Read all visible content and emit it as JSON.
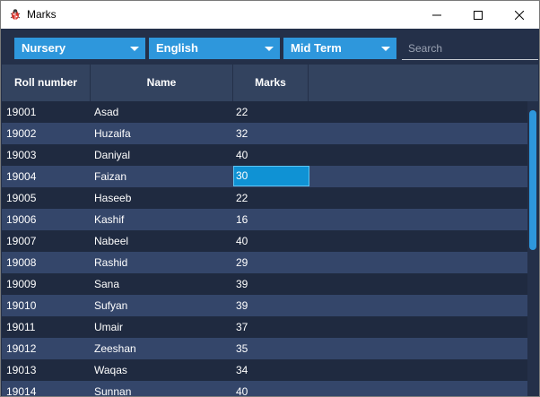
{
  "window": {
    "title": "Marks"
  },
  "toolbar": {
    "class_select": {
      "value": "Nursery"
    },
    "subject_select": {
      "value": "English"
    },
    "term_select": {
      "value": "Mid Term"
    },
    "search": {
      "placeholder": "Search"
    }
  },
  "table": {
    "columns": [
      "Roll number",
      "Name",
      "Marks"
    ],
    "rows": [
      {
        "roll": "19001",
        "name": "Asad",
        "marks": "22"
      },
      {
        "roll": "19002",
        "name": "Huzaifa",
        "marks": "32"
      },
      {
        "roll": "19003",
        "name": "Daniyal",
        "marks": "40"
      },
      {
        "roll": "19004",
        "name": "Faizan",
        "marks": "30"
      },
      {
        "roll": "19005",
        "name": "Haseeb",
        "marks": "22"
      },
      {
        "roll": "19006",
        "name": "Kashif",
        "marks": "16"
      },
      {
        "roll": "19007",
        "name": "Nabeel",
        "marks": "40"
      },
      {
        "roll": "19008",
        "name": "Rashid",
        "marks": "29"
      },
      {
        "roll": "19009",
        "name": "Sana",
        "marks": "39"
      },
      {
        "roll": "19010",
        "name": "Sufyan",
        "marks": "39"
      },
      {
        "roll": "19011",
        "name": "Umair",
        "marks": "37"
      },
      {
        "roll": "19012",
        "name": "Zeeshan",
        "marks": "35"
      },
      {
        "roll": "19013",
        "name": "Waqas",
        "marks": "34"
      },
      {
        "roll": "19014",
        "name": "Sunnan",
        "marks": "40"
      }
    ],
    "selected_cell": {
      "row": 3,
      "column": "marks"
    }
  },
  "icons": {
    "app": "bug-icon",
    "minimize": "minimize-icon",
    "maximize": "maximize-icon",
    "close": "close-icon",
    "dropdown": "chevron-down-icon"
  },
  "colors": {
    "background": "#243049",
    "header": "#33435f",
    "row_dark": "#1f2a40",
    "row_light": "#34466a",
    "accent": "#2e97dc",
    "selected_cell": "#0f92d4"
  }
}
